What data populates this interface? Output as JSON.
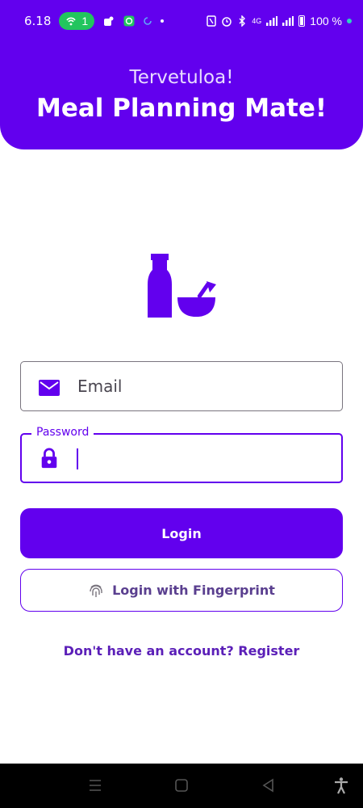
{
  "status_bar": {
    "time": "6.18",
    "hotspot_count": "1",
    "battery": "100 %",
    "network": "4G",
    "icons_left": [
      "hotspot-icon",
      "teams-icon",
      "app-icon",
      "sync-icon",
      "dot-icon"
    ],
    "icons_right": [
      "nfc-icon",
      "alarm-icon",
      "bluetooth-icon",
      "signal-icon",
      "signal-icon",
      "battery-icon",
      "dot-icon"
    ]
  },
  "header": {
    "welcome": "Tervetuloa!",
    "title": "Meal Planning Mate!"
  },
  "logo": {
    "icon": "food-logo-icon"
  },
  "form": {
    "email": {
      "placeholder": "Email",
      "icon": "email-icon"
    },
    "password": {
      "label": "Password",
      "value": "",
      "icon": "lock-icon"
    }
  },
  "actions": {
    "login_label": "Login",
    "fingerprint_label": "Login with Fingerprint",
    "register_label": "Don't have an account? Register"
  },
  "nav_bar": {
    "items": [
      "recents-icon",
      "home-icon",
      "back-icon",
      "accessibility-icon"
    ]
  },
  "colors": {
    "primary": "#6200ee",
    "header_text": "#ffffff",
    "welcome_text": "#e9ddff",
    "field_border": "#79747e",
    "link_text": "#5b1fb8"
  }
}
